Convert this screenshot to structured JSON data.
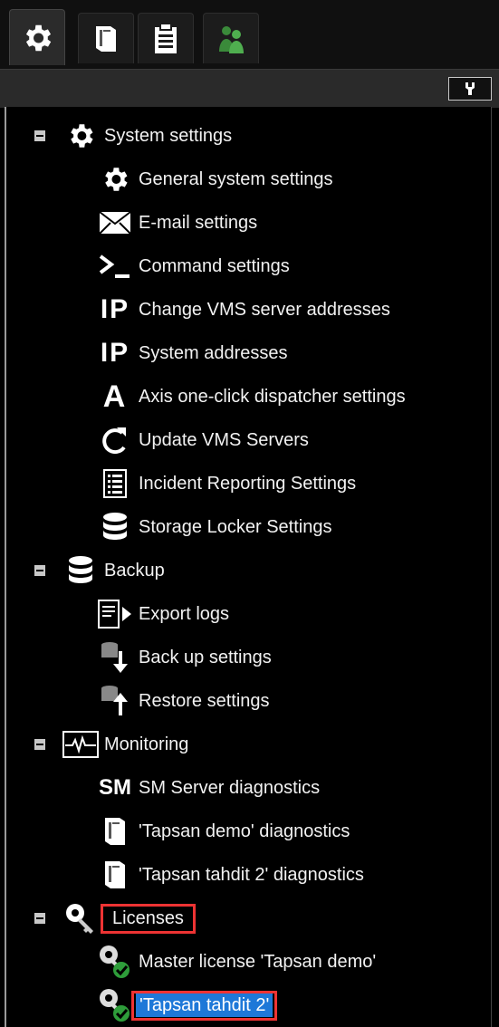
{
  "tabs": [
    {
      "icon": "gear-icon",
      "active": true
    },
    {
      "icon": "server-icon",
      "active": false
    },
    {
      "icon": "clipboard-icon",
      "active": false
    },
    {
      "icon": "users-icon",
      "active": false
    }
  ],
  "toolbar": {
    "icon": "wrench-icon"
  },
  "tree": {
    "system": {
      "label": "System settings",
      "items": [
        {
          "label": "General system settings",
          "icon": "gear-icon"
        },
        {
          "label": "E-mail settings",
          "icon": "envelope-icon"
        },
        {
          "label": "Command settings",
          "icon": "terminal-icon"
        },
        {
          "label": "Change VMS server addresses",
          "icon": "ip-icon",
          "icon_text": "IP"
        },
        {
          "label": "System addresses",
          "icon": "ip-icon",
          "icon_text": "IP"
        },
        {
          "label": "Axis one-click dispatcher settings",
          "icon": "axis-icon",
          "icon_text": "A"
        },
        {
          "label": "Update VMS Servers",
          "icon": "refresh-icon"
        },
        {
          "label": "Incident Reporting Settings",
          "icon": "list-icon"
        },
        {
          "label": "Storage Locker Settings",
          "icon": "database-icon"
        }
      ]
    },
    "backup": {
      "label": "Backup",
      "items": [
        {
          "label": "Export logs",
          "icon": "export-logs-icon"
        },
        {
          "label": "Back up settings",
          "icon": "backup-down-icon"
        },
        {
          "label": "Restore settings",
          "icon": "restore-up-icon"
        }
      ]
    },
    "monitoring": {
      "label": "Monitoring",
      "items": [
        {
          "label": "SM Server diagnostics",
          "icon": "sm-icon",
          "icon_text": "SM"
        },
        {
          "label": "'Tapsan demo' diagnostics",
          "icon": "server-icon"
        },
        {
          "label": "'Tapsan tahdit 2' diagnostics",
          "icon": "server-icon"
        }
      ]
    },
    "licenses": {
      "label": "Licenses",
      "items": [
        {
          "label": "Master license 'Tapsan demo'",
          "icon": "license-key-icon"
        },
        {
          "label": "'Tapsan tahdit 2'",
          "icon": "license-key-icon",
          "selected": true
        }
      ]
    }
  },
  "colors": {
    "selection": "#1e78d8",
    "highlight_border": "#e33333",
    "key_green": "#2e9d3a"
  }
}
